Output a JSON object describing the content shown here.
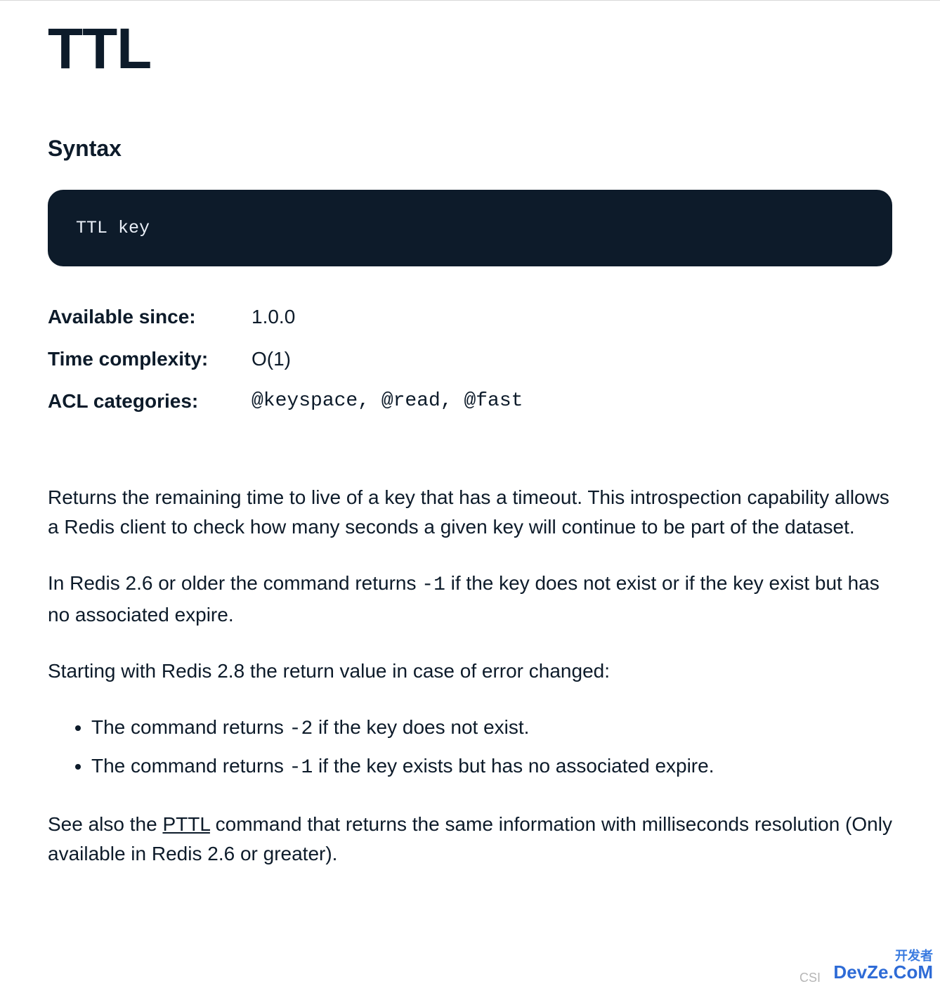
{
  "title": "TTL",
  "syntax_heading": "Syntax",
  "syntax_code": "TTL key",
  "meta": {
    "available_since_label": "Available since:",
    "available_since_value": "1.0.0",
    "time_complexity_label": "Time complexity:",
    "time_complexity_value": "O(1)",
    "acl_categories_label": "ACL categories:",
    "acl_categories_value": "@keyspace, @read, @fast"
  },
  "body": {
    "p1": "Returns the remaining time to live of a key that has a timeout. This introspection capability allows a Redis client to check how many seconds a given key will continue to be part of the dataset.",
    "p2_pre": "In Redis 2.6 or older the command returns ",
    "p2_code": "-1",
    "p2_post": " if the key does not exist or if the key exist but has no associated expire.",
    "p3": "Starting with Redis 2.8 the return value in case of error changed:",
    "li1_pre": "The command returns ",
    "li1_code": "-2",
    "li1_post": " if the key does not exist.",
    "li2_pre": "The command returns ",
    "li2_code": "-1",
    "li2_post": " if the key exists but has no associated expire.",
    "p4_pre": "See also the ",
    "p4_link": "PTTL",
    "p4_post": " command that returns the same information with milliseconds resolution (Only available in Redis 2.6 or greater)."
  },
  "watermark": {
    "top": "开发者",
    "bottom": "DevZe.CoM",
    "csdn": "CSI"
  }
}
